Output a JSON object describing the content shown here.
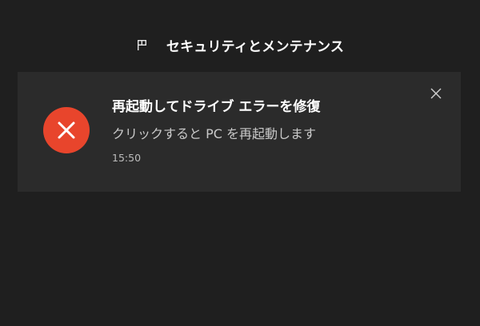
{
  "header": {
    "icon": "security-maintenance-flag-icon",
    "title": "セキュリティとメンテナンス"
  },
  "notification": {
    "status_icon": "error-x-icon",
    "status_color": "#e8452c",
    "title": "再起動してドライブ エラーを修復",
    "body": "クリックすると PC を再起動します",
    "time": "15:50",
    "close_icon": "close-icon"
  },
  "colors": {
    "background": "#1f1f1f",
    "toast_background": "#2b2b2b"
  }
}
